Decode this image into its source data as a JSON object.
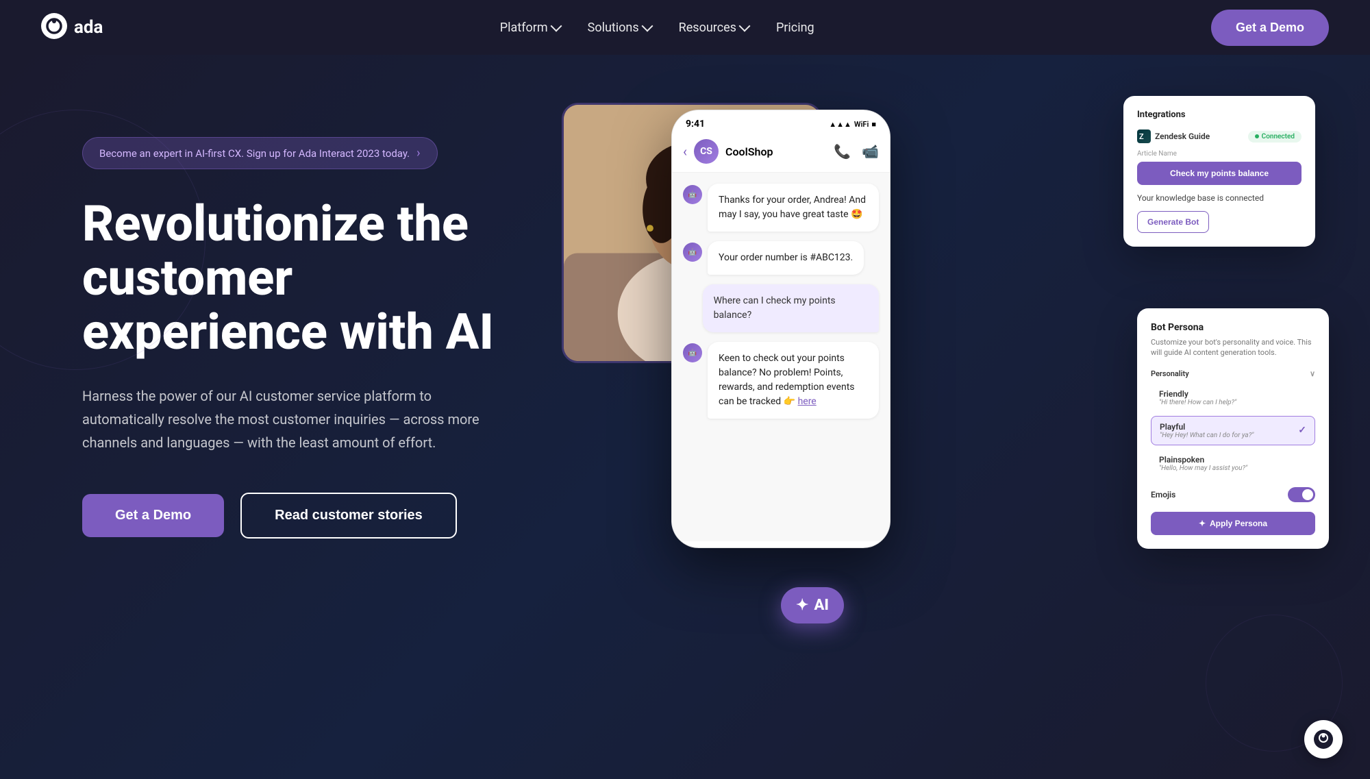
{
  "brand": {
    "name": "ada",
    "logo_alt": "Ada logo"
  },
  "nav": {
    "links": [
      {
        "label": "Platform",
        "has_dropdown": true
      },
      {
        "label": "Solutions",
        "has_dropdown": true
      },
      {
        "label": "Resources",
        "has_dropdown": true
      },
      {
        "label": "Pricing",
        "has_dropdown": false
      }
    ],
    "cta_label": "Get a Demo"
  },
  "hero": {
    "badge_text": "Become an expert in AI-first CX. Sign up for Ada Interact 2023 today.",
    "title": "Revolutionize the customer experience with AI",
    "description": "Harness the power of our AI customer service platform to automatically resolve the most customer inquiries — across more channels and languages — with the least amount of effort.",
    "btn_primary": "Get a Demo",
    "btn_secondary": "Read customer stories"
  },
  "phone": {
    "time": "9:41",
    "shop_name": "CoolShop",
    "messages": [
      {
        "type": "bot",
        "text": "Thanks for your order, Andrea! And may I say, you have great taste 🤩"
      },
      {
        "type": "bot",
        "text": "Your order number is #ABC123."
      },
      {
        "type": "user",
        "text": "Where can I check my points balance?"
      },
      {
        "type": "bot",
        "text": "Keen to check out your points balance? No problem! Points, rewards, and redemption events can be tracked 👉"
      }
    ],
    "chat_link": "here"
  },
  "integrations": {
    "title": "Integrations",
    "zendesk_label": "Zendesk Guide",
    "connected_label": "Connected",
    "article_name_label": "Article Name",
    "check_points_btn": "Check my points balance",
    "knowledge_base_text": "Your knowledge base is connected",
    "generate_bot_btn": "Generate Bot"
  },
  "bot_persona": {
    "title": "Bot Persona",
    "description": "Customize your bot's personality and voice. This will guide AI content generation tools.",
    "personality_label": "Personality",
    "options": [
      {
        "label": "Friendly",
        "preview": "\"Hi there! How can I help?\"",
        "selected": false
      },
      {
        "label": "Playful",
        "preview": "\"Hey Hey! What can I do for ya?\"",
        "selected": true
      },
      {
        "label": "Plainspoken",
        "preview": "\"Hello, How may I assist you?\"",
        "selected": false
      }
    ],
    "emojis_label": "Emojis",
    "apply_btn": "Apply Persona"
  },
  "ai_badge": "✦ AI",
  "chat_widget_alt": "Chat widget"
}
